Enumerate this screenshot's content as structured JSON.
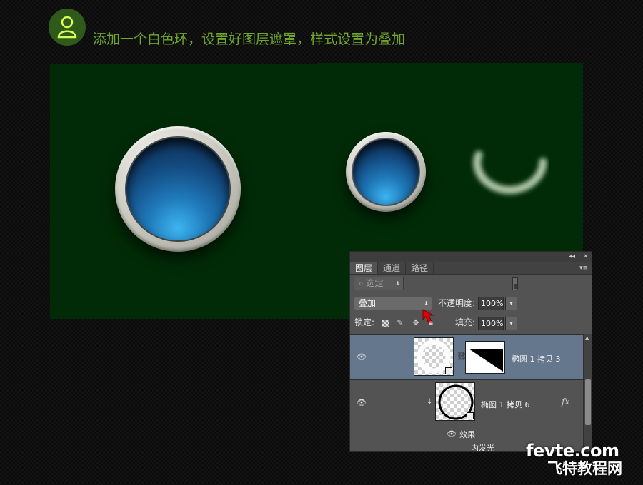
{
  "step": {
    "badge_icon": "person-outline-icon",
    "badge_glyph": "8",
    "title": "添加一个白色环，设置好图层遮罩，样式设置为叠加"
  },
  "colors": {
    "canvas_green": "#002b06",
    "title_green": "#6fa62c",
    "selected_layer": "#64778c",
    "arrow_red": "#e00000"
  },
  "layers_panel": {
    "tabs": [
      {
        "label": "图层",
        "active": true
      },
      {
        "label": "通道",
        "active": false
      },
      {
        "label": "路径",
        "active": false
      }
    ],
    "filter": {
      "label": "选定"
    },
    "blend_mode": "叠加",
    "opacity": {
      "label": "不透明度:",
      "value": "100%"
    },
    "lock": {
      "label": "锁定:"
    },
    "fill": {
      "label": "填充:",
      "value": "100%"
    },
    "layers": [
      {
        "name": "椭圆 1 拷贝 3",
        "selected": true,
        "has_mask": true
      },
      {
        "name": "椭圆 1 拷贝 6",
        "selected": false,
        "clipped": true,
        "has_fx": true,
        "effects_label": "效果",
        "effects": [
          "内发光"
        ]
      }
    ],
    "fx_label": "fx"
  },
  "watermark": {
    "line1": "fevte.com",
    "line2": "飞特教程网"
  }
}
